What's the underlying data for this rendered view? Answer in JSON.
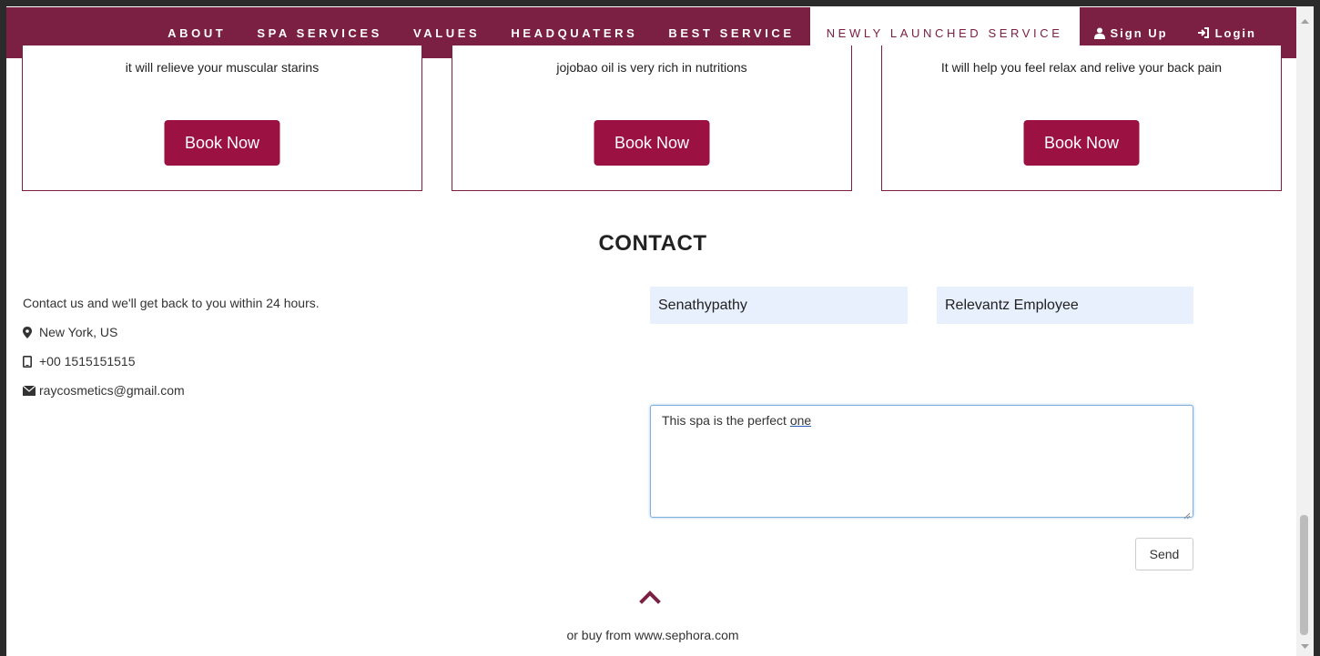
{
  "nav": {
    "items": [
      "ABOUT",
      "SPA SERVICES",
      "VALUES",
      "HEADQUATERS",
      "BEST SERVICE"
    ],
    "active_item": "NEWLY LAUNCHED SERVICE",
    "signup_label": "Sign Up",
    "login_label": "Login",
    "signup_icon": "user-icon",
    "login_icon": "login-icon"
  },
  "cards": [
    {
      "text": "it will relieve your muscular starins",
      "button": "Book Now"
    },
    {
      "text": "jojobao oil is very rich in nutritions",
      "button": "Book Now"
    },
    {
      "text": "It will help you feel relax and relive your back pain",
      "button": "Book Now"
    }
  ],
  "contact": {
    "title": "CONTACT",
    "intro": "Contact us and we'll get back to you within 24 hours.",
    "location": "New York, US",
    "phone": "+00 1515151515",
    "email": "raycosmetics@gmail.com",
    "name_value": "Senathypathy",
    "email_field_value": "Relevantz Employee",
    "message_part1": "This spa is the perfect ",
    "message_part2": "one",
    "send_label": "Send"
  },
  "footer": {
    "text": "or buy from www.sephora.com"
  },
  "colors": {
    "brand": "#7b2042",
    "button": "#9b1242",
    "input_bg": "#e8f0fe"
  }
}
